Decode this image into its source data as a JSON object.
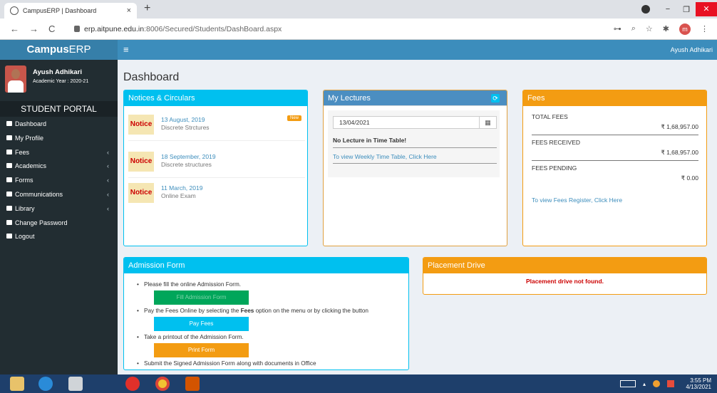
{
  "browser": {
    "tab_title": "CampusERP | Dashboard",
    "tab_close": "×",
    "new_tab": "+",
    "url_host": "erp.aitpune.edu.in",
    "url_path": ":8006/Secured/Students/DashBoard.aspx",
    "profile_initial": "m",
    "nav": {
      "back": "←",
      "forward": "→",
      "reload": "C"
    },
    "window": {
      "minimize": "−",
      "restore": "❐",
      "close": "✕"
    },
    "toolbar_icons": {
      "key": "o-key-icon",
      "zoom": "zoom-icon",
      "star": "star-icon",
      "extensions": "puzzle-icon",
      "menu": "⋮"
    }
  },
  "app": {
    "brand_bold": "Campus",
    "brand_rest": "ERP",
    "burger": "≡",
    "top_user": "Ayush Adhikari"
  },
  "sidebar": {
    "user_name": "Ayush Adhikari",
    "academic_year": "Academic Year : 2020-21",
    "portal": "STUDENT PORTAL",
    "items": [
      {
        "label": "Dashboard",
        "icon": "bank-icon",
        "chevron": ""
      },
      {
        "label": "My Profile",
        "icon": "user-icon",
        "chevron": ""
      },
      {
        "label": "Fees",
        "icon": "gear-icon",
        "chevron": "‹"
      },
      {
        "label": "Academics",
        "icon": "folder-icon",
        "chevron": "‹"
      },
      {
        "label": "Forms",
        "icon": "folder-icon",
        "chevron": "‹"
      },
      {
        "label": "Communications",
        "icon": "folder-icon",
        "chevron": "‹"
      },
      {
        "label": "Library",
        "icon": "book-icon",
        "chevron": "‹"
      },
      {
        "label": "Change Password",
        "icon": "lock-icon",
        "chevron": ""
      },
      {
        "label": "Logout",
        "icon": "power-icon",
        "chevron": ""
      }
    ]
  },
  "page": {
    "title": "Dashboard"
  },
  "notices": {
    "header": "Notices & Circulars",
    "items": [
      {
        "tag": "Notice",
        "date": "13 August, 2019",
        "subject": "Discrete Strctures",
        "badge": "New"
      },
      {
        "tag": "Notice",
        "date": "18 September, 2019",
        "subject": "Discrete structures",
        "badge": ""
      },
      {
        "tag": "Notice",
        "date": "11 March, 2019",
        "subject": "Online Exam",
        "badge": ""
      }
    ]
  },
  "lectures": {
    "header": "My Lectures",
    "date_value": "13/04/2021",
    "calendar_icon": "▦",
    "refresh_icon": "⟳",
    "no_lecture": "No Lecture in Time Table!",
    "weekly_link": "To view Weekly Time Table, Click Here"
  },
  "fees": {
    "header": "Fees",
    "rows": [
      {
        "label": "TOTAL FEES",
        "amount": "₹ 1,68,957.00"
      },
      {
        "label": "FEES RECEIVED",
        "amount": "₹ 1,68,957.00"
      },
      {
        "label": "FEES PENDING",
        "amount": "₹ 0.00"
      }
    ],
    "register_link": "To view Fees Register, Click Here"
  },
  "admission": {
    "header": "Admission Form",
    "step1": "Please fill the online Admission Form.",
    "btn_fill": "Fill Admission Form",
    "step2_pre": "Pay the Fees Online by selecting the ",
    "step2_bold": "Fees",
    "step2_post": " option on the menu or by clicking the button",
    "btn_pay": "Pay Fees",
    "step3": "Take a printout of the Admission Form.",
    "btn_print": "Print Form",
    "step4": "Submit the Signed Admission Form along with documents in Office"
  },
  "placement": {
    "header": "Placement Drive",
    "message": "Placement drive not found."
  },
  "taskbar": {
    "time": "3:55 PM",
    "date": "4/13/2021",
    "tray_arrow": "▴"
  }
}
